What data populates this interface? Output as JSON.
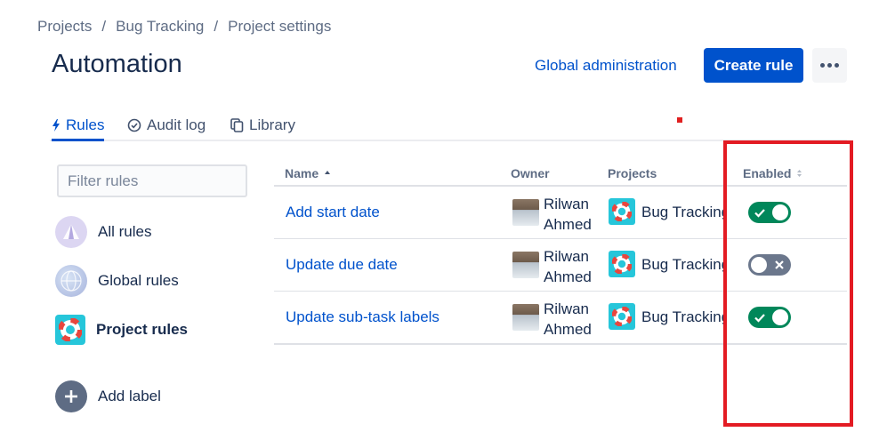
{
  "breadcrumb": {
    "items": [
      "Projects",
      "Bug Tracking",
      "Project settings"
    ],
    "separator": "/"
  },
  "page": {
    "title": "Automation"
  },
  "header": {
    "global_admin_label": "Global administration",
    "create_rule_label": "Create rule",
    "more_icon": "more-horizontal-icon"
  },
  "tabs": [
    {
      "label": "Rules",
      "icon": "lightning-icon",
      "active": true
    },
    {
      "label": "Audit log",
      "icon": "check-circle-icon",
      "active": false
    },
    {
      "label": "Library",
      "icon": "copy-icon",
      "active": false
    }
  ],
  "sidebar": {
    "filter_placeholder": "Filter rules",
    "filter_value": "",
    "items": [
      {
        "label": "All rules",
        "icon": "all-rules-icon",
        "active": false
      },
      {
        "label": "Global rules",
        "icon": "globe-icon",
        "active": false
      },
      {
        "label": "Project rules",
        "icon": "project-lifebuoy-icon",
        "active": true
      }
    ],
    "add_label": "Add label"
  },
  "table": {
    "columns": [
      "Name",
      "Owner",
      "Projects",
      "Enabled"
    ],
    "rows": [
      {
        "name": "Add start date",
        "owner": "Rilwan Ahmed",
        "project": "Bug Tracking",
        "enabled": true
      },
      {
        "name": "Update due date",
        "owner": "Rilwan Ahmed",
        "project": "Bug Tracking",
        "enabled": false
      },
      {
        "name": "Update sub-task labels",
        "owner": "Rilwan Ahmed",
        "project": "Bug Tracking",
        "enabled": true
      }
    ]
  },
  "colors": {
    "primary": "#0052cc",
    "toggle_on": "#00875a",
    "toggle_off": "#6b778c",
    "highlight": "#e31b23",
    "project_icon_bg": "#26c6da"
  }
}
